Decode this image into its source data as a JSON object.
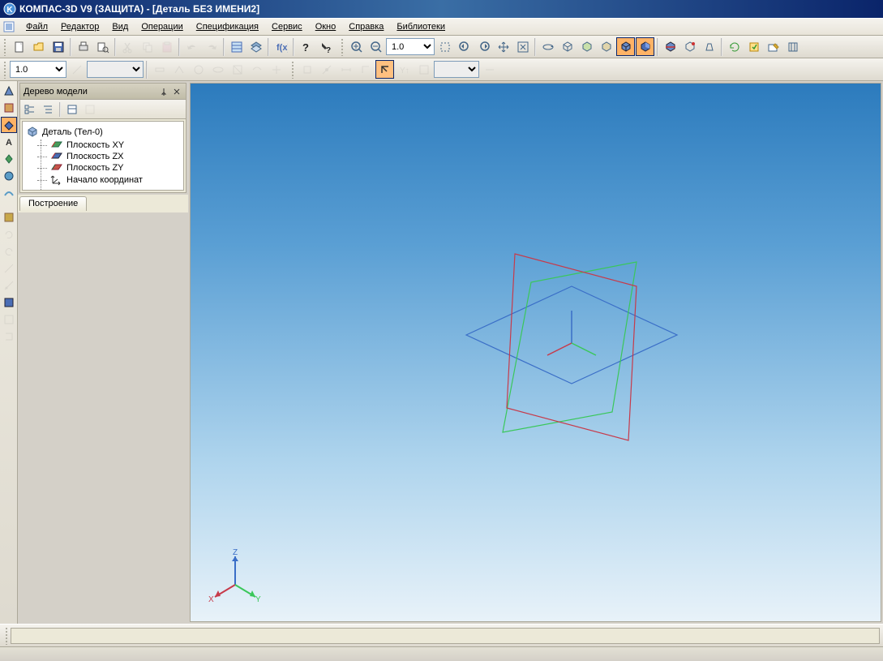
{
  "title": "КОМПАС-3D V9 (ЗАЩИТА) - [Деталь БЕЗ ИМЕНИ2]",
  "menus": [
    "Файл",
    "Редактор",
    "Вид",
    "Операции",
    "Спецификация",
    "Сервис",
    "Окно",
    "Справка",
    "Библиотеки"
  ],
  "toolbar1_combo": "1.0",
  "toolbar2_combo": "1.0",
  "tree": {
    "header": "Дерево модели",
    "root": "Деталь (Тел-0)",
    "items": [
      "Плоскость XY",
      "Плоскость ZX",
      "Плоскость ZY",
      "Начало координат"
    ],
    "tab": "Построение"
  },
  "triad": {
    "x": "X",
    "y": "Y",
    "z": "Z"
  }
}
